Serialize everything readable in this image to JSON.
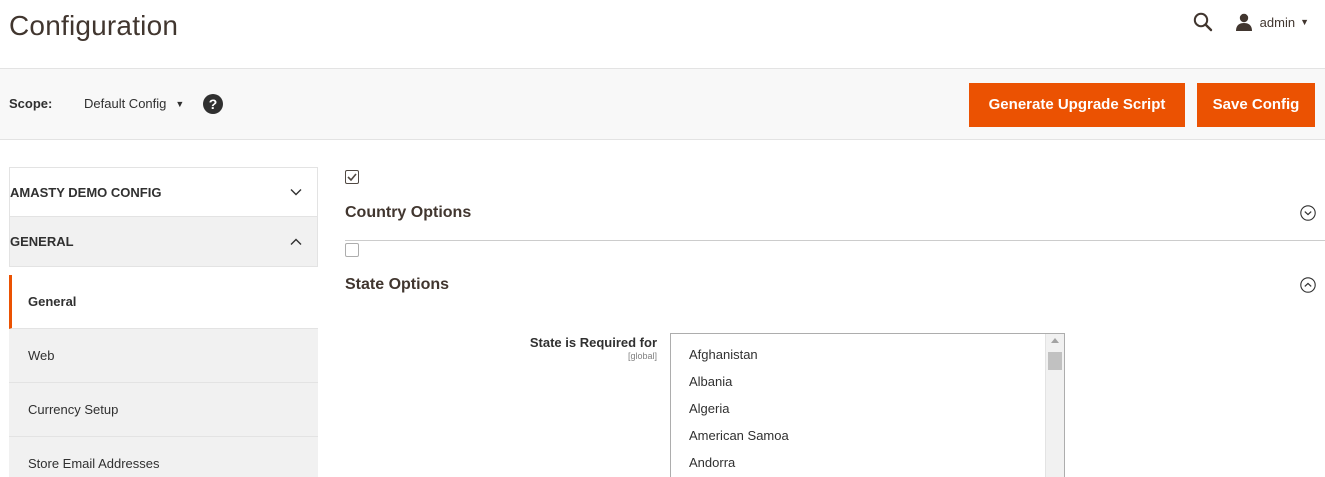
{
  "header": {
    "title": "Configuration",
    "user": "admin"
  },
  "scope": {
    "label": "Scope:",
    "value": "Default Config",
    "help": "?"
  },
  "actions": {
    "upgrade_label": "Generate Upgrade Script",
    "save_label": "Save Config"
  },
  "sidebar": {
    "sections": [
      {
        "title": "AMASTY DEMO CONFIG",
        "expanded": false
      },
      {
        "title": "GENERAL",
        "expanded": true
      }
    ],
    "items": [
      {
        "label": "General",
        "active": true
      },
      {
        "label": "Web",
        "active": false
      },
      {
        "label": "Currency Setup",
        "active": false
      },
      {
        "label": "Store Email Addresses",
        "active": false
      }
    ]
  },
  "main": {
    "sections": [
      {
        "title": "Country Options",
        "checked": true,
        "expanded": false
      },
      {
        "title": "State Options",
        "checked": false,
        "expanded": true
      }
    ],
    "field": {
      "label": "State is Required for",
      "scope": "[global]",
      "options": [
        "Afghanistan",
        "Albania",
        "Algeria",
        "American Samoa",
        "Andorra"
      ]
    }
  },
  "colors": {
    "accent": "#eb5202",
    "text": "#303030",
    "sidebar_bg": "#f1f1f1",
    "bar_bg": "#f8f8f8"
  },
  "icons": [
    "search-icon",
    "user-icon",
    "caret-down-icon",
    "help-icon",
    "chevron-down-icon",
    "chevron-up-icon",
    "circle-chevron-down-icon",
    "circle-chevron-up-icon",
    "checkmark-icon"
  ]
}
